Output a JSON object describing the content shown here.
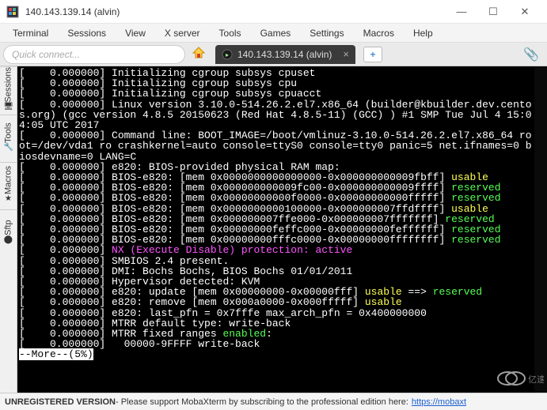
{
  "window": {
    "title": "140.143.139.14 (alvin)",
    "min": "—",
    "max": "☐",
    "close": "✕"
  },
  "menu": {
    "terminal": "Terminal",
    "sessions": "Sessions",
    "view": "View",
    "xserver": "X server",
    "tools": "Tools",
    "games": "Games",
    "settings": "Settings",
    "macros": "Macros",
    "help": "Help"
  },
  "quick": {
    "placeholder": "Quick connect..."
  },
  "tab": {
    "label": "140.143.139.14 (alvin)",
    "close": "×",
    "new": "+"
  },
  "sidebar": {
    "sessions": "Sessions",
    "tools": "Tools",
    "macros": "Macros",
    "sftp": "Sftp"
  },
  "term": {
    "lines": [
      {
        "t": "[    0.000000] Initializing cgroup subsys cpuset"
      },
      {
        "t": "[    0.000000] Initializing cgroup subsys cpu"
      },
      {
        "t": "[    0.000000] Initializing cgroup subsys cpuacct"
      },
      {
        "t": "[    0.000000] Linux version 3.10.0-514.26.2.el7.x86_64 (builder@kbuilder.dev.centos.org) (gcc version 4.8.5 20150623 (Red Hat 4.8.5-11) (GCC) ) #1 SMP Tue Jul 4 15:04:05 UTC 2017"
      },
      {
        "t": "[    0.000000] Command line: BOOT_IMAGE=/boot/vmlinuz-3.10.0-514.26.2.el7.x86_64 root=/dev/vda1 ro crashkernel=auto console=ttyS0 console=tty0 panic=5 net.ifnames=0 biosdevname=0 LANG=C"
      },
      {
        "t": "[    0.000000] e820: BIOS-provided physical RAM map:"
      },
      {
        "seg": [
          {
            "c": "",
            "t": "[    0.000000] BIOS-e820: [mem 0x0000000000000000-0x000000000009fbff] "
          },
          {
            "c": "yellow",
            "t": "usable"
          }
        ]
      },
      {
        "seg": [
          {
            "c": "",
            "t": "[    0.000000] BIOS-e820: [mem 0x000000000009fc00-0x000000000009ffff] "
          },
          {
            "c": "green",
            "t": "reserved"
          }
        ]
      },
      {
        "seg": [
          {
            "c": "",
            "t": "[    0.000000] BIOS-e820: [mem 0x00000000000f0000-0x00000000000fffff] "
          },
          {
            "c": "green",
            "t": "reserved"
          }
        ]
      },
      {
        "seg": [
          {
            "c": "",
            "t": "[    0.000000] BIOS-e820: [mem 0x0000000000100000-0x000000007ffdffff] "
          },
          {
            "c": "yellow",
            "t": "usable"
          }
        ]
      },
      {
        "seg": [
          {
            "c": "",
            "t": "[    0.000000] BIOS-e820: [mem 0x000000007ffe000-0x000000007fffffff] "
          },
          {
            "c": "green",
            "t": "reserved"
          }
        ]
      },
      {
        "seg": [
          {
            "c": "",
            "t": "[    0.000000] BIOS-e820: [mem 0x00000000feffc000-0x00000000feffffff] "
          },
          {
            "c": "green",
            "t": "reserved"
          }
        ]
      },
      {
        "seg": [
          {
            "c": "",
            "t": "[    0.000000] BIOS-e820: [mem 0x00000000fffc0000-0x00000000ffffffff] "
          },
          {
            "c": "green",
            "t": "reserved"
          }
        ]
      },
      {
        "seg": [
          {
            "c": "",
            "t": "[    0.000000] "
          },
          {
            "c": "magenta",
            "t": "NX (Execute Disable) protection: active"
          }
        ]
      },
      {
        "t": "[    0.000000] SMBIOS 2.4 present."
      },
      {
        "t": "[    0.000000] DMI: Bochs Bochs, BIOS Bochs 01/01/2011"
      },
      {
        "t": "[    0.000000] Hypervisor detected: KVM"
      },
      {
        "seg": [
          {
            "c": "",
            "t": "[    0.000000] e820: update [mem 0x00000000-0x00000fff] "
          },
          {
            "c": "yellow",
            "t": "usable"
          },
          {
            "c": "",
            "t": " ==> "
          },
          {
            "c": "green",
            "t": "reserved"
          }
        ]
      },
      {
        "seg": [
          {
            "c": "",
            "t": "[    0.000000] e820: remove [mem 0x000a0000-0x000fffff] "
          },
          {
            "c": "yellow",
            "t": "usable"
          }
        ]
      },
      {
        "t": "[    0.000000] e820: last_pfn = 0x7fffe max_arch_pfn = 0x400000000"
      },
      {
        "t": "[    0.000000] MTRR default type: write-back"
      },
      {
        "seg": [
          {
            "c": "",
            "t": "[    0.000000] MTRR fixed ranges "
          },
          {
            "c": "green",
            "t": "enabled"
          },
          {
            "c": "",
            "t": ":"
          }
        ]
      },
      {
        "t": "[    0.000000]   00000-9FFFF write-back"
      }
    ],
    "more": "--More--(5%)"
  },
  "footer": {
    "unreg": "UNREGISTERED VERSION",
    "msg": " - Please support MobaXterm by subscribing to the professional edition here: ",
    "link": "https://mobaxt"
  },
  "watermark": "亿速云"
}
